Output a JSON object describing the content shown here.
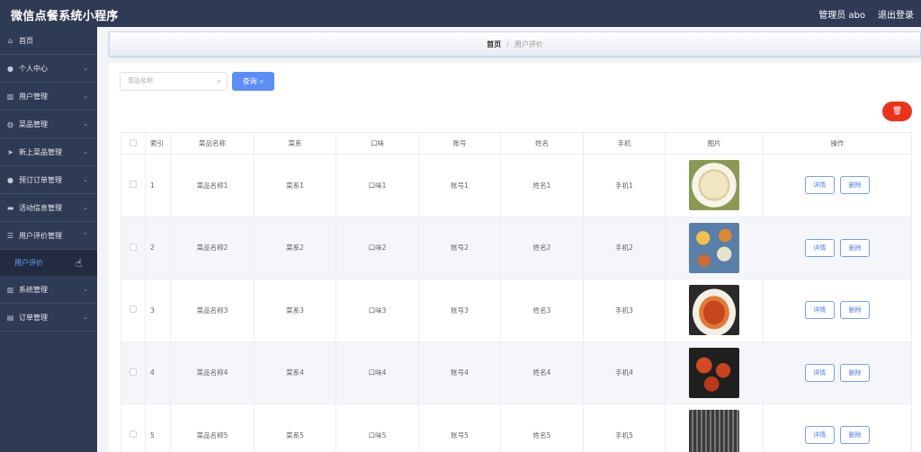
{
  "header": {
    "title": "微信点餐系统小程序",
    "admin": "管理员 abo",
    "logout": "退出登录"
  },
  "sidebar": {
    "home": "首页",
    "items": [
      {
        "label": "个人中心",
        "icon": "user-icon"
      },
      {
        "label": "用户管理",
        "icon": "chart-icon"
      },
      {
        "label": "菜品管理",
        "icon": "mic-icon"
      },
      {
        "label": "新上菜品管理",
        "icon": "send-icon"
      },
      {
        "label": "预订订单管理",
        "icon": "user-icon"
      },
      {
        "label": "活动信息管理",
        "icon": "message-icon"
      },
      {
        "label": "用户评价管理",
        "icon": "list-icon"
      },
      {
        "label": "系统管理",
        "icon": "chart-icon"
      },
      {
        "label": "订单管理",
        "icon": "doc-icon"
      }
    ],
    "active_sub": "用户评价"
  },
  "breadcrumb": {
    "home": "首页",
    "sep": "/",
    "current": "用户评价"
  },
  "search": {
    "placeholder": "菜品名称",
    "button": "查询"
  },
  "table": {
    "headers": [
      "索引",
      "菜品名称",
      "菜系",
      "口味",
      "账号",
      "姓名",
      "手机",
      "图片",
      "操作"
    ],
    "rows": [
      {
        "idx": "1",
        "name": "菜品名称1",
        "cuisine": "菜系1",
        "taste": "口味1",
        "account": "账号1",
        "person": "姓名1",
        "phone": "手机1"
      },
      {
        "idx": "2",
        "name": "菜品名称2",
        "cuisine": "菜系2",
        "taste": "口味2",
        "account": "账号2",
        "person": "姓名2",
        "phone": "手机2"
      },
      {
        "idx": "3",
        "name": "菜品名称3",
        "cuisine": "菜系3",
        "taste": "口味3",
        "account": "账号3",
        "person": "姓名3",
        "phone": "手机3"
      },
      {
        "idx": "4",
        "name": "菜品名称4",
        "cuisine": "菜系4",
        "taste": "口味4",
        "account": "账号4",
        "person": "姓名4",
        "phone": "手机4"
      },
      {
        "idx": "5",
        "name": "菜品名称5",
        "cuisine": "菜系5",
        "taste": "口味5",
        "account": "账号5",
        "person": "姓名5",
        "phone": "手机5"
      }
    ],
    "detail_label": "详情",
    "delete_label": "删除"
  },
  "colors": {
    "nav_bg": "#2f3a54",
    "accent": "#5d8ef5",
    "danger": "#e8341c"
  }
}
